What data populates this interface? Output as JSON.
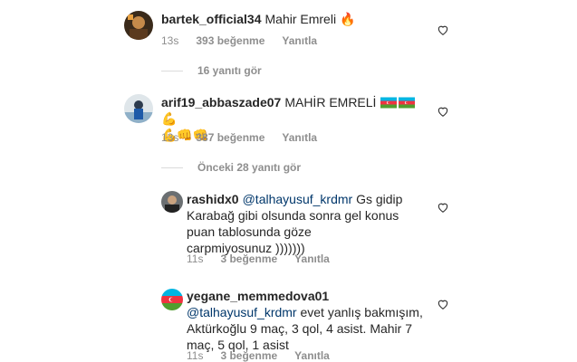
{
  "comments": [
    {
      "username": "bartek_official34",
      "text": "Mahir Emreli",
      "emoji": "🔥",
      "time": "13s",
      "likes": "393 beğenme",
      "reply": "Yanıtla",
      "view_replies": "16 yanıtı gör"
    },
    {
      "username": "arif19_abbaszade07",
      "text": "MAHİR EMRELİ",
      "emoji_line2": "💪👊👊",
      "time": "13s",
      "likes": "387 beğenme",
      "reply": "Yanıtla",
      "view_replies": "Önceki 28 yanıtı gör"
    }
  ],
  "replies": [
    {
      "username": "rashidx0",
      "mention": "@talhayusuf_krdmr",
      "line1": "Gs gidip",
      "line2": "Karabağ gibi olsunda sonra gel konus",
      "line3": "puan tablosunda göze",
      "line4": "carpmiyosunuz )))))))",
      "time": "11s",
      "likes": "3 beğenme",
      "reply": "Yanıtla"
    },
    {
      "username": "yegane_memmedova01",
      "mention": "@talhayusuf_krdmr",
      "line1": "evet yanlış bakmışım,",
      "line2": "Aktürkoğlu 9 maç, 3 qol, 4 asist. Mahir 7",
      "line3": "maç, 5 qol, 1 asist",
      "time": "11s",
      "likes": "3 beğenme",
      "reply": "Yanıtla"
    }
  ],
  "colors": {
    "text": "#262626",
    "secondary": "#8e8e8e",
    "mention": "#00376b",
    "divider": "#dbdbdb"
  },
  "icons": {
    "like": "heart-outline-icon",
    "flag": "azerbaijan-flag-icon"
  }
}
